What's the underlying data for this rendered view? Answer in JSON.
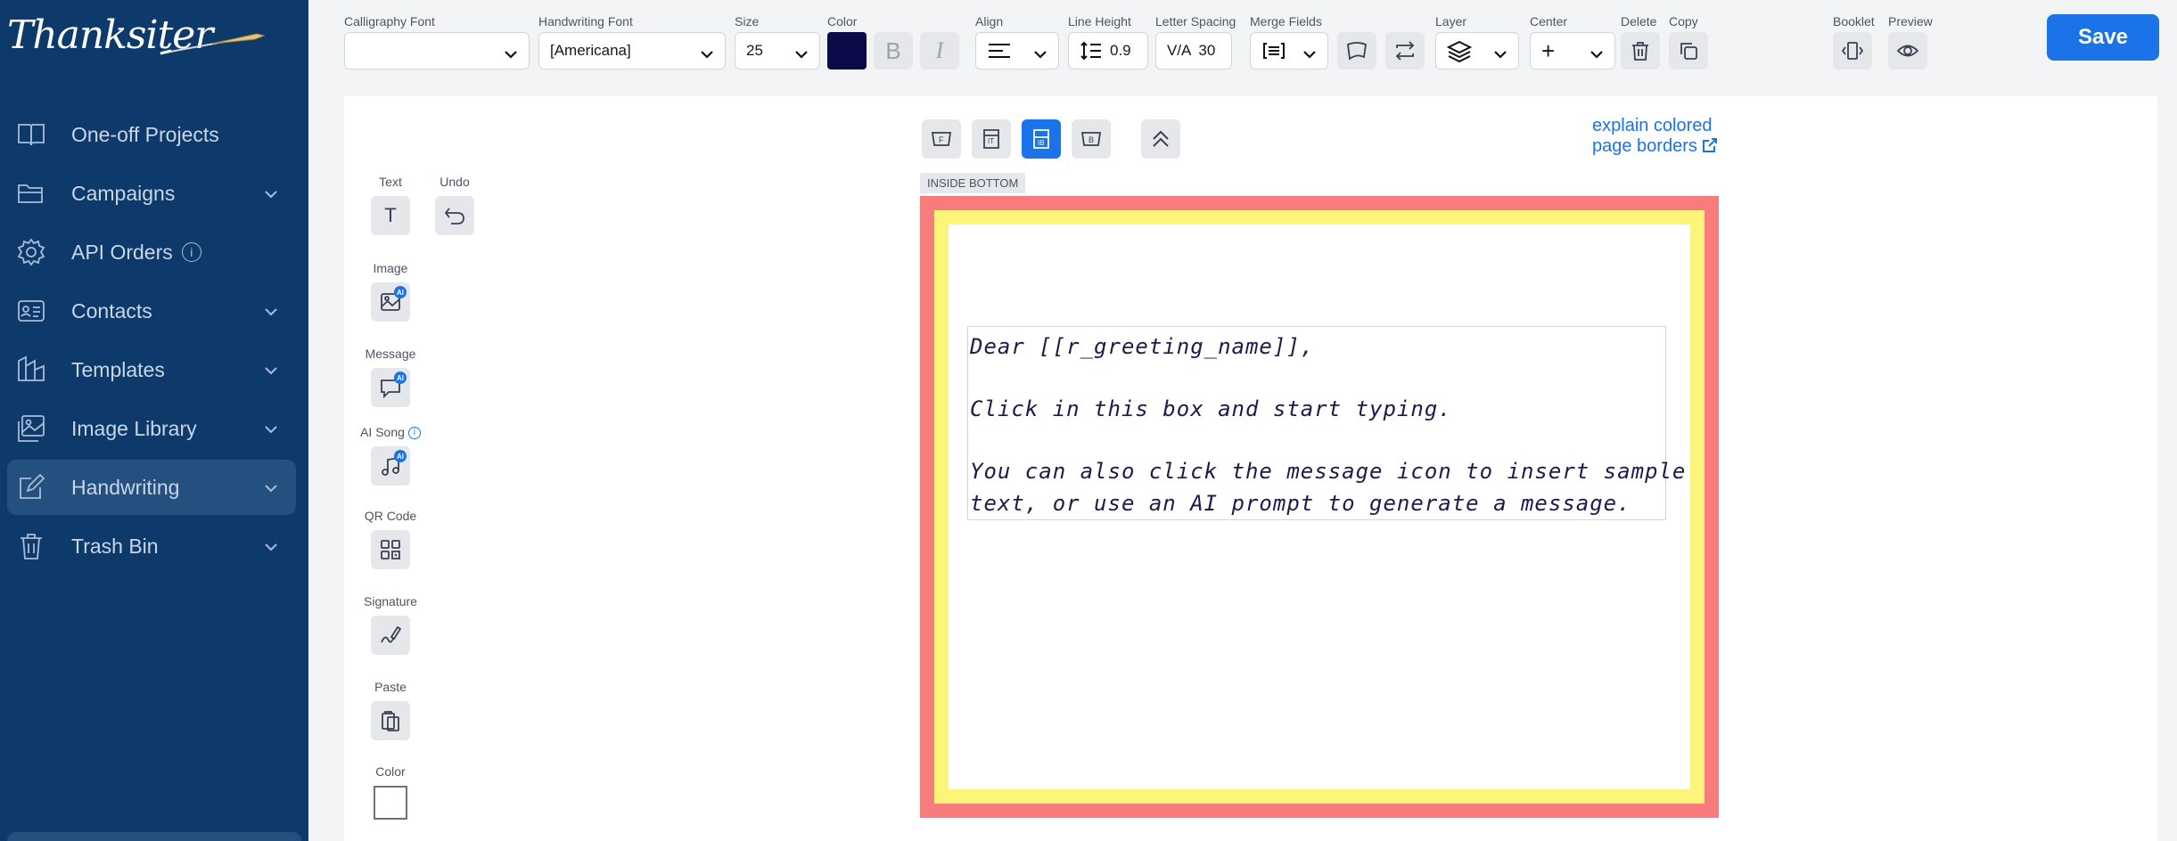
{
  "sidebar": {
    "logo": "Thanksiter",
    "items": [
      {
        "label": "One-off Projects",
        "icon": "book-open-icon",
        "chevron": false,
        "info": false,
        "active": false
      },
      {
        "label": "Campaigns",
        "icon": "folder-open-icon",
        "chevron": true,
        "info": false,
        "active": false
      },
      {
        "label": "API Orders",
        "icon": "gear-icon",
        "chevron": false,
        "info": true,
        "active": false
      },
      {
        "label": "Contacts",
        "icon": "contact-card-icon",
        "chevron": true,
        "info": false,
        "active": false
      },
      {
        "label": "Templates",
        "icon": "templates-icon",
        "chevron": true,
        "info": false,
        "active": false
      },
      {
        "label": "Image Library",
        "icon": "image-library-icon",
        "chevron": true,
        "info": false,
        "active": false
      },
      {
        "label": "Handwriting",
        "icon": "pencil-square-icon",
        "chevron": true,
        "info": false,
        "active": true
      },
      {
        "label": "Trash Bin",
        "icon": "trash-icon",
        "chevron": true,
        "info": false,
        "active": false
      }
    ],
    "info_glyph": "i"
  },
  "toolbar": {
    "calligraphy_font": {
      "label": "Calligraphy Font",
      "value": ""
    },
    "handwriting_font": {
      "label": "Handwriting Font",
      "value": "[Americana]"
    },
    "size": {
      "label": "Size",
      "value": "25"
    },
    "color": {
      "label": "Color",
      "value": "#0b0b4a"
    },
    "bold_glyph": "B",
    "italic_glyph": "I",
    "align": {
      "label": "Align"
    },
    "line_height": {
      "label": "Line Height",
      "value": "0.9"
    },
    "letter_spacing": {
      "label": "Letter Spacing",
      "prefix": "V/A",
      "value": "30"
    },
    "merge_fields": {
      "label": "Merge Fields"
    },
    "layer": {
      "label": "Layer"
    },
    "center": {
      "label": "Center",
      "glyph": "+"
    },
    "delete": {
      "label": "Delete"
    },
    "copy": {
      "label": "Copy"
    },
    "booklet": {
      "label": "Booklet"
    },
    "preview": {
      "label": "Preview"
    },
    "save": "Save"
  },
  "tools": {
    "text": {
      "label": "Text",
      "glyph": "T"
    },
    "undo": {
      "label": "Undo"
    },
    "image": {
      "label": "Image"
    },
    "message": {
      "label": "Message"
    },
    "ai_song": {
      "label": "AI Song"
    },
    "qr_code": {
      "label": "QR Code"
    },
    "signature": {
      "label": "Signature"
    },
    "paste": {
      "label": "Paste"
    },
    "color": {
      "label": "Color",
      "value": "#ffffff"
    },
    "ai_badge": "AI",
    "info_glyph": "i"
  },
  "page_tabs": [
    {
      "glyph": "F",
      "active": false
    },
    {
      "glyph": "IT",
      "active": false
    },
    {
      "glyph": "IB",
      "active": true
    },
    {
      "glyph": "B",
      "active": false
    }
  ],
  "explain_link": {
    "line1": "explain colored",
    "line2": "page borders"
  },
  "page_label": "INSIDE BOTTOM",
  "card": {
    "border_outer": "#f87c7c",
    "border_inner": "#fdf579",
    "text_lines": [
      "Dear [[r_greeting_name]],",
      "",
      "Click in this box and start typing.",
      "",
      "You can also click the message icon to insert sample",
      "text, or use an AI prompt to generate a message."
    ]
  }
}
